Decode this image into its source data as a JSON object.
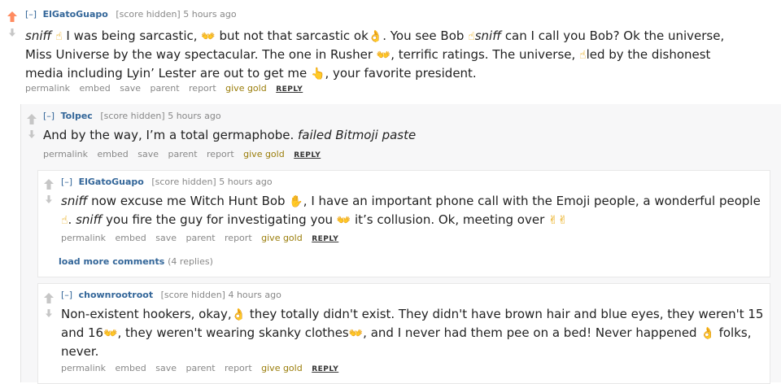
{
  "comments": [
    {
      "toggle": "[–]",
      "author": "ElGatoGuapo",
      "score": "[score hidden]",
      "time": "5 hours ago",
      "lines": [
        [
          "sniff",
          " ",
          "☝",
          " I was being sarcastic, ",
          "👐",
          " but not that sarcastic ok",
          "👌",
          ". You see Bob ",
          "☝",
          "sniff",
          " can I call you Bob? Ok the universe,"
        ],
        [
          "Miss Universe by the way spectacular. The one in Rusher ",
          "👐",
          ", terrific ratings. The universe, ",
          "☝",
          "led by the dishonest"
        ],
        [
          "media including Lyin’ Lester are out to get me ",
          "👆",
          ", your favorite president."
        ]
      ]
    },
    {
      "toggle": "[–]",
      "author": "Tolpec",
      "score": "[score hidden]",
      "time": "5 hours ago",
      "text_plain": "And by the way, I’m a total germaphobe. ",
      "text_italic": "failed Bitmoji paste"
    },
    {
      "toggle": "[–]",
      "author": "ElGatoGuapo",
      "score": "[score hidden]",
      "time": "5 hours ago",
      "line1_italic": "sniff",
      "line1_a": " now excuse me Witch Hunt Bob ",
      "line1_b": ", I have an important phone call with the Emoji people, a wonderful people",
      "line2_a": ". ",
      "line2_italic": "sniff",
      "line2_b": " you fire the guy for investigating you ",
      "line2_c": " it’s collusion. Ok, meeting over "
    },
    {
      "toggle": "[–]",
      "author": "chownrootroot",
      "score": "[score hidden]",
      "time": "4 hours ago",
      "line1_a": "Non-existent hookers, okay,",
      "line1_b": " they totally didn't exist. They didn't have brown hair and blue eyes, they weren't 15",
      "line2_a": "and 16",
      "line2_b": ", they weren't wearing skanky clothes",
      "line2_c": ", and I never had them pee on a bed! Never happened ",
      "line2_d": " folks,",
      "line3": "never."
    }
  ],
  "buttons": {
    "permalink": "permalink",
    "embed": "embed",
    "save": "save",
    "parent": "parent",
    "report": "report",
    "give_gold": "give gold",
    "reply": "REPLY"
  },
  "load_more": {
    "label": "load more comments",
    "count": "(4 replies)"
  },
  "icons": {
    "upvote": "upvote-arrow-icon",
    "downvote": "downvote-arrow-icon",
    "pointing_up": "☝",
    "open_hands": "👐",
    "ok_hand": "👌",
    "raised_hand": "✋",
    "victory": "✌"
  },
  "colors": {
    "upvoted": "#ff8b60",
    "arrow_gray": "#c6c6c6",
    "author": "#336699",
    "gold": "#9a7d0a"
  }
}
